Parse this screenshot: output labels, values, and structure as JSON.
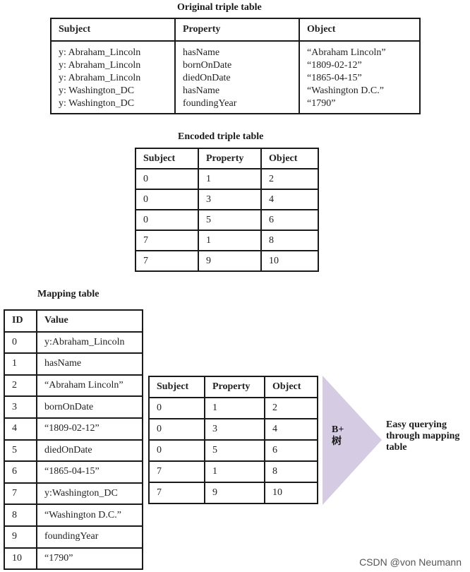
{
  "original_table": {
    "caption": "Original triple table",
    "headers": [
      "Subject",
      "Property",
      "Object"
    ],
    "subjects": "y: Abraham_Lincoln\ny: Abraham_Lincoln\ny: Abraham_Lincoln\ny: Washington_DC\ny: Washington_DC",
    "properties": "hasName\nbornOnDate\ndiedOnDate\nhasName\nfoundingYear",
    "objects": "“Abraham Lincoln”\n“1809-02-12”\n“1865-04-15”\n“Washington D.C.”\n“1790”"
  },
  "encoded_table": {
    "caption": "Encoded triple table",
    "headers": [
      "Subject",
      "Property",
      "Object"
    ],
    "rows": [
      [
        "0",
        "1",
        "2"
      ],
      [
        "0",
        "3",
        "4"
      ],
      [
        "0",
        "5",
        "6"
      ],
      [
        "7",
        "1",
        "8"
      ],
      [
        "7",
        "9",
        "10"
      ]
    ]
  },
  "mapping_table": {
    "caption": "Mapping table",
    "headers": [
      "ID",
      "Value"
    ],
    "rows": [
      [
        "0",
        "y:Abraham_Lincoln"
      ],
      [
        "1",
        "hasName"
      ],
      [
        "2",
        "“Abraham Lincoln”"
      ],
      [
        "3",
        "bornOnDate"
      ],
      [
        "4",
        "“1809-02-12”"
      ],
      [
        "5",
        "diedOnDate"
      ],
      [
        "6",
        "“1865-04-15”"
      ],
      [
        "7",
        "y:Washington_DC"
      ],
      [
        "8",
        "“Washington D.C.”"
      ],
      [
        "9",
        "foundingYear"
      ],
      [
        "10",
        "“1790”"
      ]
    ]
  },
  "bplus_table": {
    "headers": [
      "Subject",
      "Property",
      "Object"
    ],
    "rows": [
      [
        "0",
        "1",
        "2"
      ],
      [
        "0",
        "3",
        "4"
      ],
      [
        "0",
        "5",
        "6"
      ],
      [
        "7",
        "1",
        "8"
      ],
      [
        "7",
        "9",
        "10"
      ]
    ]
  },
  "bplus_arrow": {
    "label_line1": "B+",
    "label_line2": "树",
    "color": "#d5cce3"
  },
  "query_note": "Easy querying through mapping table",
  "watermark": "CSDN @von  Neumann"
}
